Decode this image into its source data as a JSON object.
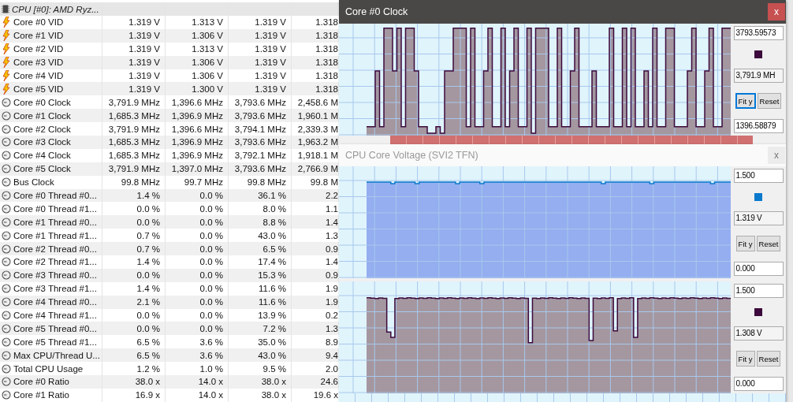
{
  "sensor_table": {
    "group": "CPU [#0]: AMD Ryz...",
    "rows": [
      {
        "kind": "voltage",
        "name": "Core #0 VID",
        "values": [
          "1.319 V",
          "1.313 V",
          "1.319 V",
          "1.318"
        ]
      },
      {
        "kind": "voltage",
        "name": "Core #1 VID",
        "values": [
          "1.319 V",
          "1.306 V",
          "1.319 V",
          "1.318"
        ]
      },
      {
        "kind": "voltage",
        "name": "Core #2 VID",
        "values": [
          "1.319 V",
          "1.313 V",
          "1.319 V",
          "1.318"
        ]
      },
      {
        "kind": "voltage",
        "name": "Core #3 VID",
        "values": [
          "1.319 V",
          "1.306 V",
          "1.319 V",
          "1.318"
        ]
      },
      {
        "kind": "voltage",
        "name": "Core #4 VID",
        "values": [
          "1.319 V",
          "1.306 V",
          "1.319 V",
          "1.318"
        ]
      },
      {
        "kind": "voltage",
        "name": "Core #5 VID",
        "values": [
          "1.319 V",
          "1.300 V",
          "1.319 V",
          "1.318"
        ]
      },
      {
        "kind": "clock",
        "name": "Core #0 Clock",
        "values": [
          "3,791.9 MHz",
          "1,396.6 MHz",
          "3,793.6 MHz",
          "2,458.6 M"
        ]
      },
      {
        "kind": "clock",
        "name": "Core #1 Clock",
        "values": [
          "1,685.3 MHz",
          "1,396.9 MHz",
          "3,793.6 MHz",
          "1,960.1 M"
        ]
      },
      {
        "kind": "clock",
        "name": "Core #2 Clock",
        "values": [
          "3,791.9 MHz",
          "1,396.6 MHz",
          "3,794.1 MHz",
          "2,339.3 M"
        ]
      },
      {
        "kind": "clock",
        "name": "Core #3 Clock",
        "values": [
          "1,685.3 MHz",
          "1,396.9 MHz",
          "3,793.6 MHz",
          "1,963.2 M"
        ]
      },
      {
        "kind": "clock",
        "name": "Core #4 Clock",
        "values": [
          "1,685.3 MHz",
          "1,396.9 MHz",
          "3,792.1 MHz",
          "1,918.1 M"
        ]
      },
      {
        "kind": "clock",
        "name": "Core #5 Clock",
        "values": [
          "3,791.9 MHz",
          "1,397.0 MHz",
          "3,793.6 MHz",
          "2,766.9 M"
        ]
      },
      {
        "kind": "clock",
        "name": "Bus Clock",
        "values": [
          "99.8 MHz",
          "99.7 MHz",
          "99.8 MHz",
          "99.8 M"
        ]
      },
      {
        "kind": "clock",
        "name": "Core #0 Thread #0...",
        "values": [
          "1.4 %",
          "0.0 %",
          "36.1 %",
          "2.2"
        ]
      },
      {
        "kind": "clock",
        "name": "Core #0 Thread #1...",
        "values": [
          "0.0 %",
          "0.0 %",
          "8.0 %",
          "1.1"
        ]
      },
      {
        "kind": "clock",
        "name": "Core #1 Thread #0...",
        "values": [
          "0.0 %",
          "0.0 %",
          "8.8 %",
          "1.4"
        ]
      },
      {
        "kind": "clock",
        "name": "Core #1 Thread #1...",
        "values": [
          "0.7 %",
          "0.0 %",
          "43.0 %",
          "1.3"
        ]
      },
      {
        "kind": "clock",
        "name": "Core #2 Thread #0...",
        "values": [
          "0.7 %",
          "0.0 %",
          "6.5 %",
          "0.9"
        ]
      },
      {
        "kind": "clock",
        "name": "Core #2 Thread #1...",
        "values": [
          "1.4 %",
          "0.0 %",
          "17.4 %",
          "1.4"
        ]
      },
      {
        "kind": "clock",
        "name": "Core #3 Thread #0...",
        "values": [
          "0.0 %",
          "0.0 %",
          "15.3 %",
          "0.9"
        ]
      },
      {
        "kind": "clock",
        "name": "Core #3 Thread #1...",
        "values": [
          "1.4 %",
          "0.0 %",
          "11.6 %",
          "1.9"
        ]
      },
      {
        "kind": "clock",
        "name": "Core #4 Thread #0...",
        "values": [
          "2.1 %",
          "0.0 %",
          "11.6 %",
          "1.9"
        ]
      },
      {
        "kind": "clock",
        "name": "Core #4 Thread #1...",
        "values": [
          "0.0 %",
          "0.0 %",
          "13.9 %",
          "0.2"
        ]
      },
      {
        "kind": "clock",
        "name": "Core #5 Thread #0...",
        "values": [
          "0.0 %",
          "0.0 %",
          "7.2 %",
          "1.3"
        ]
      },
      {
        "kind": "clock",
        "name": "Core #5 Thread #1...",
        "values": [
          "6.5 %",
          "3.6 %",
          "35.0 %",
          "8.9"
        ]
      },
      {
        "kind": "clock",
        "name": "Max CPU/Thread U...",
        "values": [
          "6.5 %",
          "3.6 %",
          "43.0 %",
          "9.4"
        ]
      },
      {
        "kind": "clock",
        "name": "Total CPU Usage",
        "values": [
          "1.2 %",
          "1.0 %",
          "9.5 %",
          "2.0"
        ]
      },
      {
        "kind": "clock",
        "name": "Core #0 Ratio",
        "values": [
          "38.0 x",
          "14.0 x",
          "38.0 x",
          "24.6"
        ]
      },
      {
        "kind": "clock",
        "name": "Core #1 Ratio",
        "values": [
          "16.9 x",
          "14.0 x",
          "38.0 x",
          "19.6 x"
        ]
      }
    ]
  },
  "graph_windows": [
    {
      "title": "Core #0 Clock",
      "close": "x",
      "active": true,
      "graphs": [
        {
          "kind": "pulses",
          "color": "#3c0a3c",
          "max_field": "3793.59573",
          "value": "3,791.9 MH",
          "min_field": "1396.58879",
          "fit_button": "Fit y",
          "fit_focused": true,
          "reset_button": "Reset"
        }
      ]
    },
    {
      "title": "CPU Core Voltage (SVI2 TFN)",
      "close": "x",
      "active": false,
      "graphs": [
        {
          "kind": "steady",
          "color": "#0a7acc",
          "max_field": "1.500",
          "value": "1.319 V",
          "min_field": "0.000",
          "fit_button": "Fit y",
          "fit_focused": false,
          "reset_button": "Reset"
        },
        {
          "kind": "dips",
          "color": "#3c0a3c",
          "max_field": "1.500",
          "value": "1.308 V",
          "min_field": "0.000",
          "fit_button": "Fit y",
          "fit_focused": false,
          "reset_button": "Reset"
        }
      ]
    }
  ]
}
